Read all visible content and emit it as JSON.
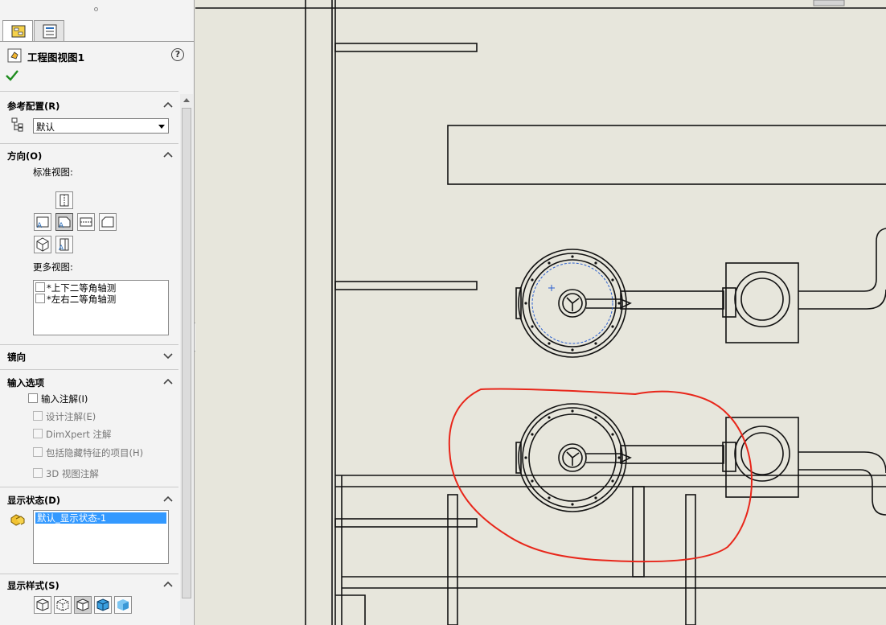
{
  "panel": {
    "title": "工程图视图1",
    "help_symbol": "?",
    "sections": {
      "reference_config": {
        "heading": "参考配置(R)",
        "selected": "默认"
      },
      "orientation": {
        "heading": "方向(O)",
        "standard_views_label": "标准视图:",
        "more_views_label": "更多视图:",
        "more_views": [
          "*上下二等角轴测",
          "*左右二等角轴测"
        ]
      },
      "mirror": {
        "heading": "镜向"
      },
      "import_options": {
        "heading": "输入选项",
        "import_annotations": "输入注解(I)",
        "design_annotations": "设计注解(E)",
        "dimxpert": "DimXpert 注解",
        "hidden_features": "包括隐藏特征的项目(H)",
        "view_3d": "3D 视图注解"
      },
      "display_state": {
        "heading": "显示状态(D)",
        "selected": "默认_显示状态-1"
      },
      "display_style": {
        "heading": "显示样式(S)"
      }
    }
  },
  "colors": {
    "sheet": "#e7e6dc",
    "selection": "#3399ff",
    "markup": "#e8261a",
    "check": "#1e8c1e"
  },
  "icons": [
    "property-tab-icon",
    "config-tab-icon",
    "drawing-view-icon",
    "help-icon",
    "ok-check-icon",
    "config-tree-icon",
    "display-state-icon",
    "wireframe-icon",
    "hidden-visible-icon",
    "hidden-removed-icon",
    "shaded-edges-icon",
    "shaded-icon"
  ]
}
